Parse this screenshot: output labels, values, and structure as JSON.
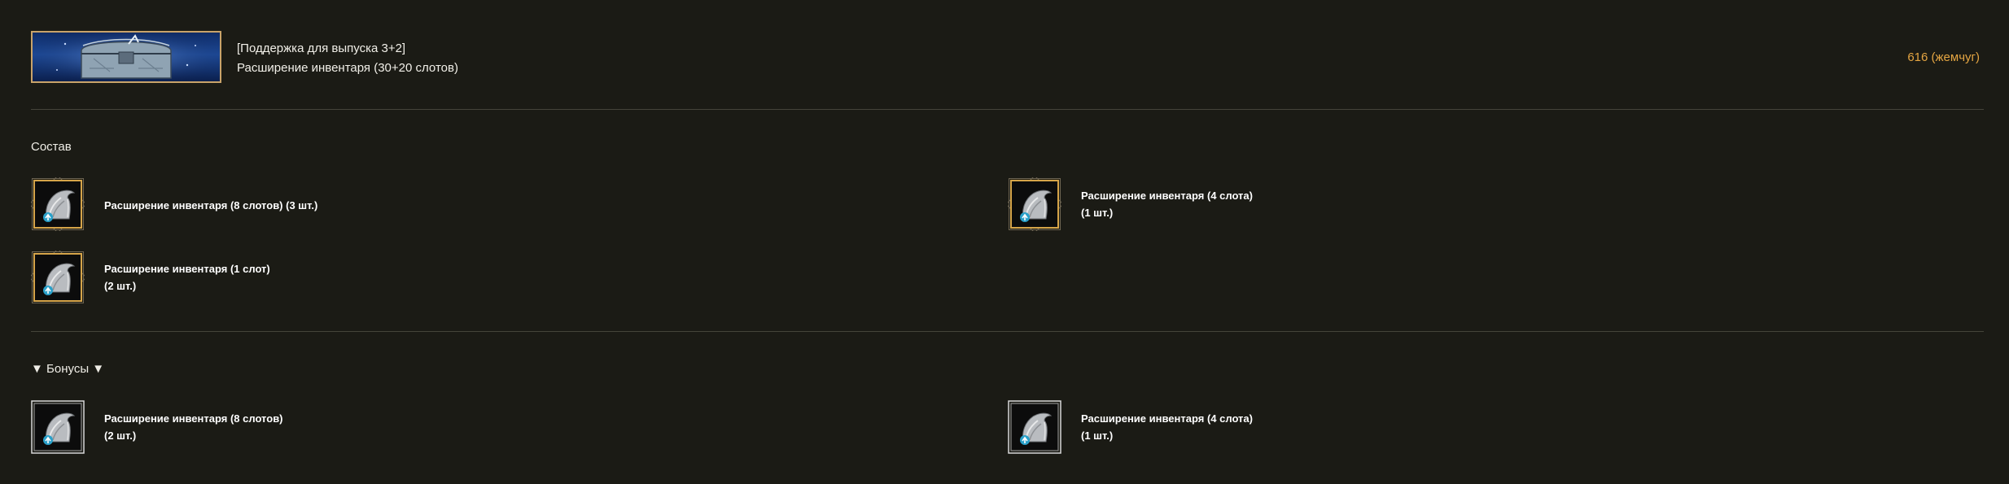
{
  "header": {
    "line1": "[Поддержка для выпуска 3+2]",
    "line2": "Расширение инвентаря (30+20 слотов)",
    "price": "616 (жемчуг)",
    "thumb_icon": "inventory-chest-icon"
  },
  "composition": {
    "title": "Состав",
    "items": [
      {
        "name": "Расширение инвентаря (8 слотов) (3 шт.)",
        "qty": "",
        "icon": "inventory-bag-icon"
      },
      {
        "name": "Расширение инвентаря (4 слота)",
        "qty": "(1 шт.)",
        "icon": "inventory-bag-icon"
      },
      {
        "name": "Расширение инвентаря (1 слот)",
        "qty": "(2 шт.)",
        "icon": "inventory-bag-icon"
      }
    ]
  },
  "bonuses": {
    "title": "▼ Бонусы ▼",
    "items": [
      {
        "name": "Расширение инвентаря (8 слотов)",
        "qty": "(2 шт.)",
        "icon": "inventory-bag-icon"
      },
      {
        "name": "Расширение инвентаря (4 слота)",
        "qty": "(1 шт.)",
        "icon": "inventory-bag-icon"
      }
    ]
  },
  "colors": {
    "background": "#1b1b15",
    "price": "#e4a542",
    "gold_frame": "#c9a36a",
    "white_frame": "#d8d8d8"
  }
}
